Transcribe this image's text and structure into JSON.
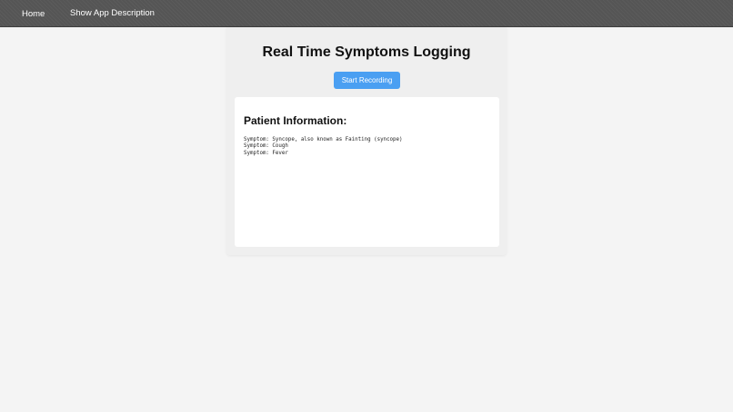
{
  "nav": {
    "home_label": "Home",
    "description_label": "Show App Description"
  },
  "main": {
    "title": "Real Time Symptoms Logging",
    "record_button_label": "Start Recording",
    "patient_info": {
      "heading": "Patient Information:",
      "symptoms": [
        "Symptom: Syncope, also known as Fainting (syncope)",
        "Symptom: Cough",
        "Symptom: Fever"
      ]
    }
  },
  "colors": {
    "navbar": "#555555",
    "page_background": "#f4f4f4",
    "panel_background": "#efefef",
    "button": "#4a9ff2"
  }
}
